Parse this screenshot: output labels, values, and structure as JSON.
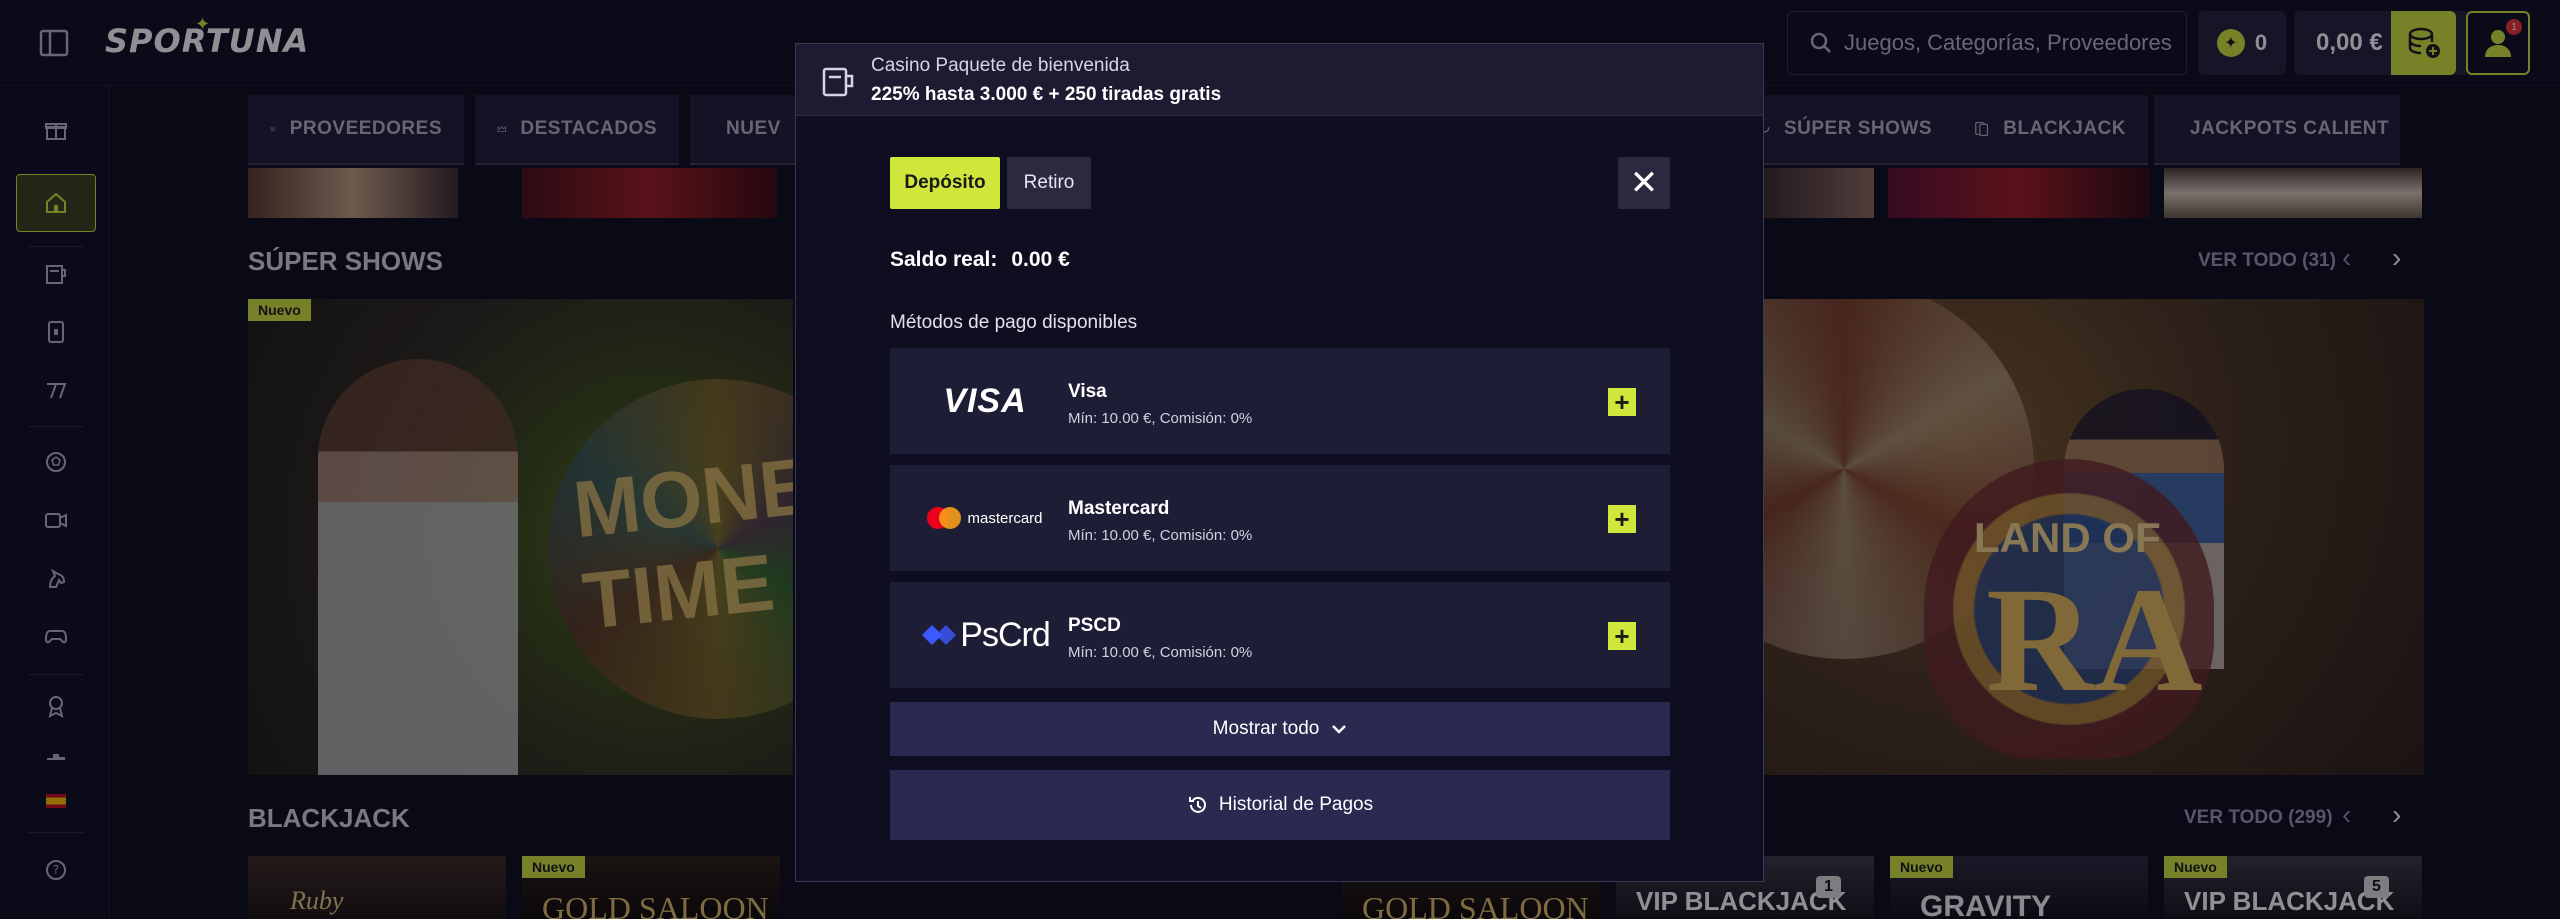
{
  "header": {
    "logo": "SPORTUNA",
    "search_placeholder": "Juegos, Categorías, Proveedores",
    "coins": "0",
    "balance": "0,00 €",
    "notification_count": "1"
  },
  "categories": [
    {
      "label": "PROVEEDORES",
      "icon": "layers-icon"
    },
    {
      "label": "DESTACADOS",
      "icon": "crown-icon"
    },
    {
      "label": "NUEV",
      "icon": "bolt-icon"
    },
    {
      "label": "SÚPER SHOWS",
      "icon": "microphone-icon"
    },
    {
      "label": "BLACKJACK",
      "icon": "cards-icon"
    },
    {
      "label": "JACKPOTS CALIENT",
      "icon": "hand-coins-icon"
    }
  ],
  "sections": [
    {
      "title": "SÚPER SHOWS",
      "see_all": "VER TODO (31)",
      "badge": "Nuevo"
    },
    {
      "title": "BLACKJACK",
      "see_all": "VER TODO (299)"
    }
  ],
  "blackjack_thumbs": [
    {
      "title": "Ruby",
      "badge": ""
    },
    {
      "title": "GOLD SALOON",
      "badge": "Nuevo"
    },
    {
      "title": "GOLD SALOON",
      "badge": ""
    },
    {
      "title": "",
      "badge": ""
    },
    {
      "title": "GOLD SALOON",
      "badge": ""
    },
    {
      "title": "VIP BLACKJACK",
      "badge": "",
      "number": "1"
    },
    {
      "title": "GRAVITY",
      "badge": "Nuevo"
    },
    {
      "title": "VIP BLACKJACK",
      "badge": "Nuevo",
      "number": "5"
    }
  ],
  "banner_left_text": "MONEY TIME",
  "banner_right_text": {
    "line1": "LAND OF",
    "line2": "RA"
  },
  "modal": {
    "promo_title": "Casino Paquete de bienvenida",
    "promo_subtitle": "225% hasta 3.000 € + 250 tiradas gratis",
    "tab_deposit": "Depósito",
    "tab_withdraw": "Retiro",
    "saldo_label": "Saldo real:",
    "saldo_value": "0.00 €",
    "methods_label": "Métodos de pago disponibles",
    "methods": [
      {
        "name": "Visa",
        "info": "Mín: 10.00 €, Comisión: 0%",
        "logo": "VISA"
      },
      {
        "name": "Mastercard",
        "info": "Mín: 10.00 €, Comisión: 0%",
        "logo": "mastercard"
      },
      {
        "name": "PSCD",
        "info": "Mín: 10.00 €, Comisión: 0%",
        "logo": "PsCrd"
      }
    ],
    "show_all": "Mostrar todo",
    "history": "Historial de Pagos"
  },
  "colors": {
    "accent": "#cfe63b",
    "background": "#0c0b1a",
    "panel": "#1e1d36"
  }
}
